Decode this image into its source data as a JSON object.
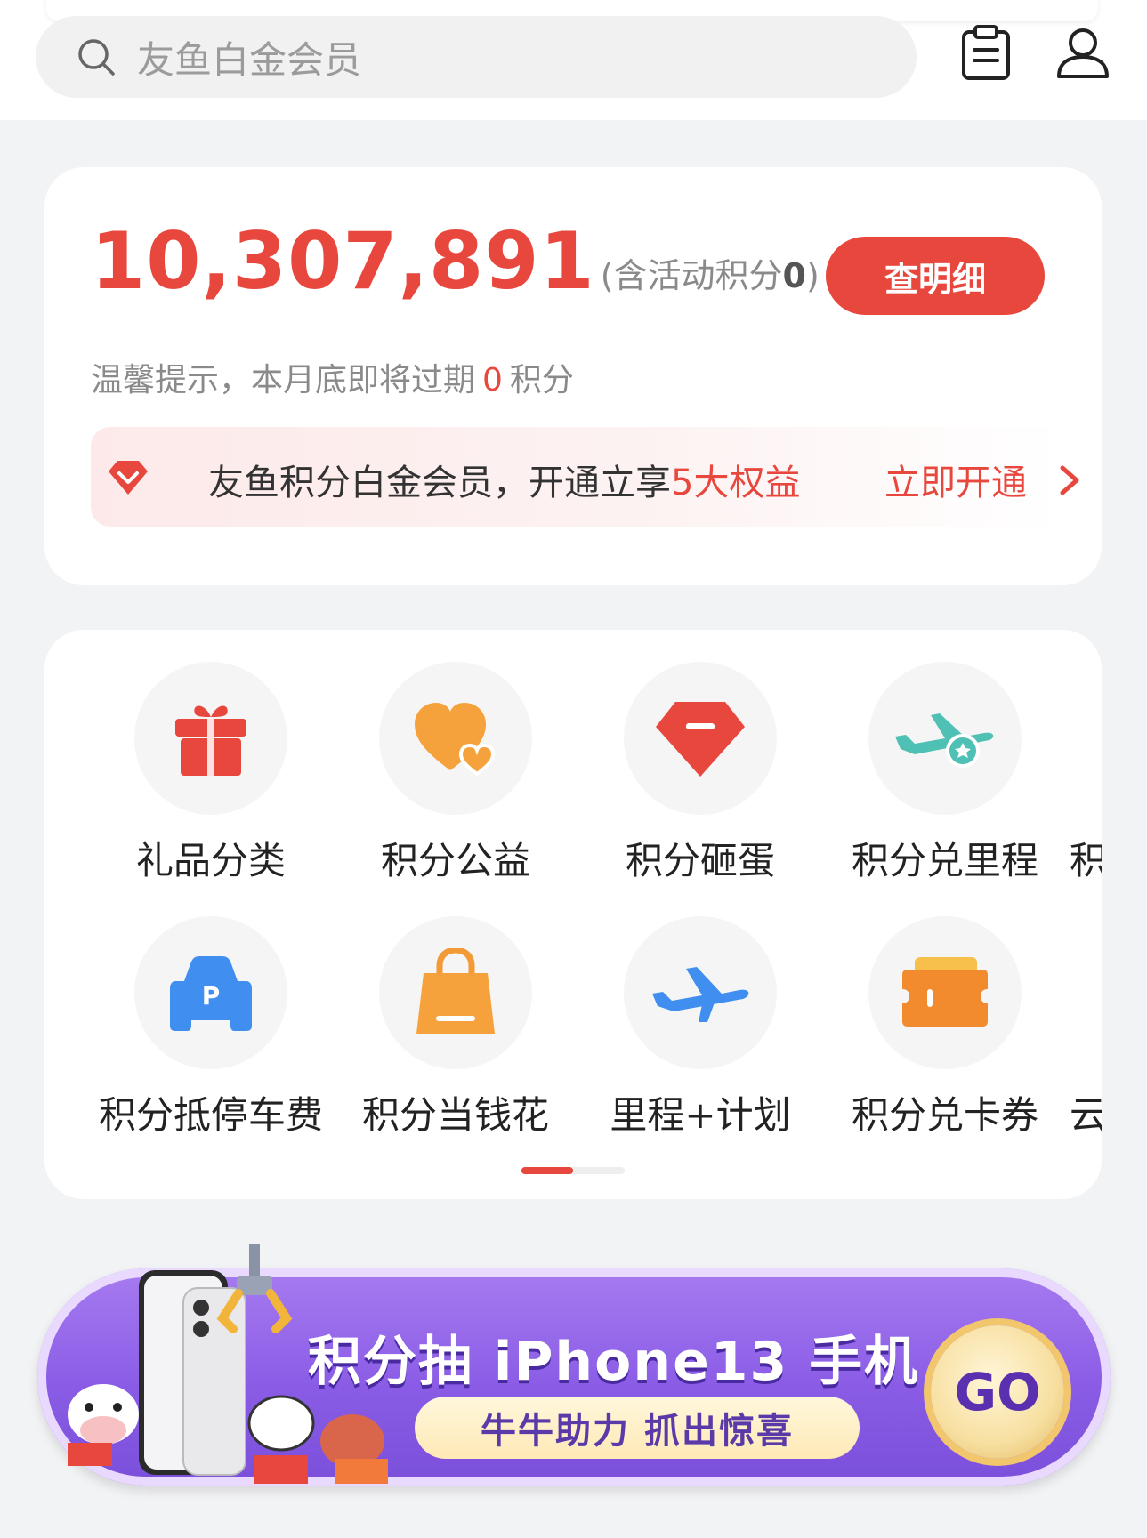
{
  "search": {
    "placeholder": "友鱼白金会员"
  },
  "points": {
    "value": "10,307,891",
    "note_prefix": "(含活动积分",
    "note_value": "0",
    "note_suffix": ")",
    "detail_button": "查明细"
  },
  "tip": {
    "prefix": "温馨提示，本月底即将过期",
    "value": "0",
    "suffix": "积分"
  },
  "member": {
    "text": "友鱼积分白金会员，开通立享",
    "highlight": "5大权益",
    "action": "立即开通"
  },
  "grid": {
    "row1": [
      "礼品分类",
      "积分公益",
      "积分砸蛋",
      "积分兑里程",
      "积分"
    ],
    "row2": [
      "积分抵停车费",
      "积分当钱花",
      "里程+计划",
      "积分兑卡券",
      "云"
    ]
  },
  "banner": {
    "title": "积分抽 iPhone13 手机",
    "subtitle": "牛牛助力 抓出惊喜",
    "go": "GO"
  },
  "colors": {
    "accent": "#e8473e",
    "banner_purple": "#8a5ce6"
  }
}
